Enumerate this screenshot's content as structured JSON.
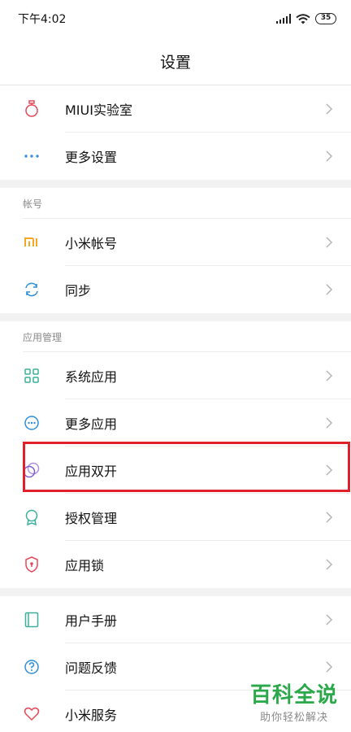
{
  "status_bar": {
    "time": "下午4:02",
    "battery": "35"
  },
  "header": {
    "title": "设置"
  },
  "groups": [
    {
      "header": "",
      "items": [
        {
          "label": "MIUI实验室",
          "icon": "lab-flask-icon"
        },
        {
          "label": "更多设置",
          "icon": "more-dots-icon"
        }
      ]
    },
    {
      "header": "帐号",
      "items": [
        {
          "label": "小米帐号",
          "icon": "mi-logo-icon"
        },
        {
          "label": "同步",
          "icon": "sync-icon"
        }
      ]
    },
    {
      "header": "应用管理",
      "items": [
        {
          "label": "系统应用",
          "icon": "grid-apps-icon"
        },
        {
          "label": "更多应用",
          "icon": "more-apps-icon"
        },
        {
          "label": "应用双开",
          "icon": "dual-apps-icon"
        },
        {
          "label": "授权管理",
          "icon": "permission-badge-icon"
        },
        {
          "label": "应用锁",
          "icon": "app-lock-shield-icon"
        }
      ]
    },
    {
      "header": "",
      "items": [
        {
          "label": "用户手册",
          "icon": "manual-book-icon"
        },
        {
          "label": "问题反馈",
          "icon": "feedback-question-icon"
        },
        {
          "label": "小米服务",
          "icon": "heart-service-icon"
        }
      ]
    }
  ],
  "highlighted_item": "应用双开",
  "watermark": {
    "main": "百科全说",
    "sub": "助你轻松解决"
  },
  "colors": {
    "highlight": "#e0202a",
    "lab": "#e34a5a",
    "more": "#3a8fd8",
    "mi": "#f5a623",
    "sync": "#2f8fd8",
    "system_apps": "#3bb09a",
    "more_apps": "#2f8fd8",
    "dual": "#8b6fd8",
    "permission": "#3bb09a",
    "lock": "#e34a5a",
    "manual": "#3bb09a",
    "feedback": "#2f8fd8",
    "heart": "#e34a5a",
    "watermark": "#2aa84a"
  }
}
